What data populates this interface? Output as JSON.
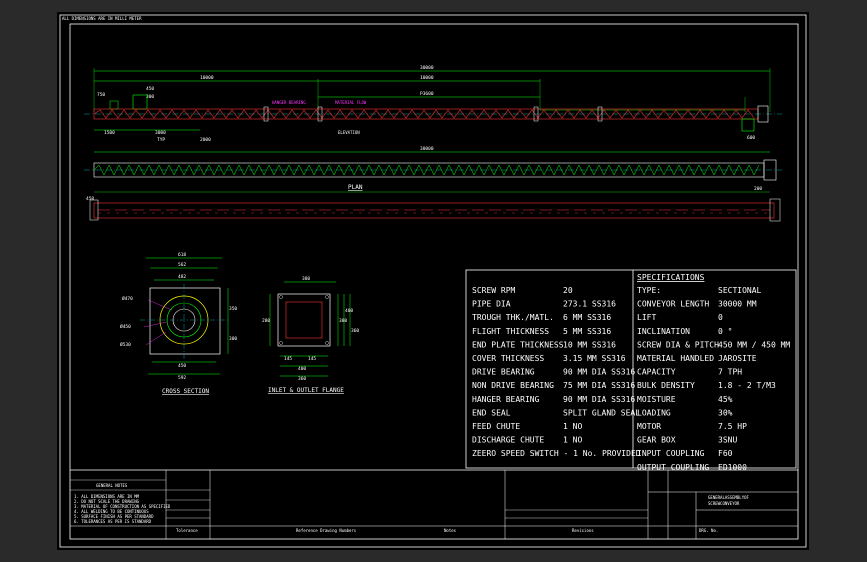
{
  "colors": {
    "background": "#2a2a2a",
    "sheet": "#000000",
    "frame": "#ffffff",
    "dimension": "#00ff00",
    "conveyor": "#ff3333",
    "flange": "#ffff00",
    "centerline": "#00cccc",
    "magenta": "#ff33ff"
  },
  "elevation": {
    "title": "ELEVATION",
    "dims": {
      "overall": "30000",
      "span_left": "10000",
      "span_mid": "10000",
      "p3600": "P3600",
      "d750": "750",
      "d450": "450",
      "d300": "300",
      "d1500": "1500",
      "d3000": "3000",
      "d2000": "2000",
      "typ": "TYP",
      "d600": "600"
    },
    "labels": {
      "hanger": "HANGER BEARING",
      "flow": "MATERIAL FLOW"
    }
  },
  "plan": {
    "title": "PLAN",
    "dims": {
      "overall": "30000",
      "d450": "450",
      "d200": "200"
    }
  },
  "cross_section": {
    "title": "CROSS SECTION",
    "dims": {
      "w618": "618",
      "w562": "562",
      "w482": "482",
      "w450": "450",
      "w592": "592",
      "ptc": "PTC 406",
      "pt0": "Ø450",
      "pt1": "Ø470",
      "pt2": "Ø530",
      "h350": "350",
      "h300": "300"
    }
  },
  "flange": {
    "title": "INLET & OUTLET FLANGE",
    "dims": {
      "top": "380",
      "bottom1": "400",
      "bottom2": "360",
      "left": "280",
      "r1": "380",
      "r2": "400",
      "r3": "360",
      "pitch1": "145",
      "pitch2": "145"
    }
  },
  "specs_left": [
    {
      "label": "SCREW RPM",
      "value": "20"
    },
    {
      "label": "PIPE DIA",
      "value": "273.1 SS316"
    },
    {
      "label": "TROUGH THK./MATL.",
      "value": "6 MM SS316"
    },
    {
      "label": "FLIGHT THICKNESS",
      "value": "5 MM SS316"
    },
    {
      "label": "END PLATE THICKNESS",
      "value": "10 MM SS316"
    },
    {
      "label": "COVER THICKNESS",
      "value": "3.15 MM SS316"
    },
    {
      "label": "DRIVE BEARING",
      "value": "90 MM DIA SS316"
    },
    {
      "label": "NON DRIVE BEARING",
      "value": "75 MM DIA SS316"
    },
    {
      "label": "HANGER BEARING",
      "value": "90 MM DIA SS316"
    },
    {
      "label": "END SEAL",
      "value": "SPLIT GLAND SEAL"
    },
    {
      "label": "FEED CHUTE",
      "value": "1 NO"
    },
    {
      "label": "DISCHARGE CHUTE",
      "value": "1 NO"
    }
  ],
  "specs_left_last": "ZEERO SPEED SWITCH - 1 No. PROVIDED",
  "specs_right_title": "SPECIFICATIONS",
  "specs_right": [
    {
      "label": "TYPE:",
      "value": "SECTIONAL"
    },
    {
      "label": "CONVEYOR LENGTH",
      "value": "30000 MM"
    },
    {
      "label": "LIFT",
      "value": "0"
    },
    {
      "label": "INCLINATION",
      "value": "0 °"
    },
    {
      "label": "SCREW DIA & PITCH",
      "value": "450 MM / 450 MM"
    },
    {
      "label": "MATERIAL HANDLED",
      "value": "JAROSITE"
    },
    {
      "label": "CAPACITY",
      "value": "7 TPH"
    },
    {
      "label": "BULK DENSITY",
      "value": "1.8 - 2 T/M3"
    },
    {
      "label": "MOISTURE",
      "value": "45%"
    },
    {
      "label": "LOADING",
      "value": "30%"
    },
    {
      "label": "MOTOR",
      "value": "7.5 HP"
    },
    {
      "label": "GEAR BOX",
      "value": "3SNU"
    },
    {
      "label": "INPUT COUPLING",
      "value": "F60"
    },
    {
      "label": "OUTPUT COUPLING",
      "value": "ED1000"
    }
  ],
  "header_note": "ALL DIMENSIONS ARE IN MILLI METER",
  "notes": {
    "title": "GENERAL NOTES",
    "lines": [
      "1. ALL DIMENSIONS ARE IN MM",
      "2. DO NOT SCALE THE DRAWING",
      "3. MATERIAL OF CONSTRUCTION AS SPECIFIED",
      "4. ALL WELDING TO BE CONTINUOUS",
      "5. SURFACE FINISH AS PER STANDARD",
      "6. TOLERANCES AS PER IS STANDARD"
    ]
  },
  "tolerance": "Tolerance",
  "ref_drawing": "Reference Drawing Numbers",
  "notes_footer": "Notes",
  "revisions_footer": "Revisions",
  "title_block": {
    "title1": "GENERALASSEMBLYOF",
    "title2": "SCREWCONVEYOR",
    "dwg_no": "DRG. No."
  }
}
